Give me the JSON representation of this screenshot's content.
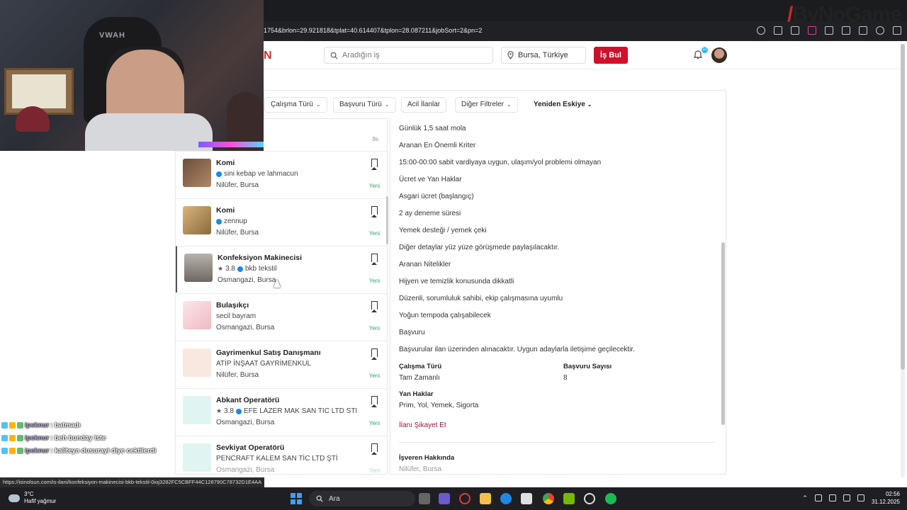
{
  "browser": {
    "url": "1754&brlon=29.921818&tplat=40.614407&tplon=28.087211&jobSort=2&pn=2",
    "status_url": "https://isinolsun.com/is-ilani/konfeksiyon-makinecisi-bkb-tekstil-0ioj3282FC5CBFF44C128790C78732D1E4AA",
    "brand_overlay": "ByNoGame"
  },
  "header": {
    "logo_fragment": "N",
    "search_placeholder": "Aradığın iş",
    "location_value": "Bursa, Türkiye",
    "find_button": "İş Bul",
    "notification_count": "10"
  },
  "filters": {
    "items": [
      "Çalışma Türü",
      "Başvuru Türü",
      "Acil İlanlar",
      "Diğer Filtreler"
    ],
    "sort_label": "Yeniden Eskiye"
  },
  "job_list": {
    "top_time": "9s",
    "new_label": "Yeni",
    "jobs": [
      {
        "title": "Komi",
        "company": "sini kebap ve lahmacun",
        "rating": "",
        "verified": true,
        "location": "Nilüfer, Bursa",
        "thumb_color": "#8a6a52"
      },
      {
        "title": "Komi",
        "company": "zennup",
        "rating": "",
        "verified": true,
        "location": "Nilüfer, Bursa",
        "thumb_color": "#c29a62"
      },
      {
        "title": "Konfeksiyon Makinecisi",
        "company": "bkb tekstil",
        "rating": "3.8",
        "verified": true,
        "location": "Osmangazi, Bursa",
        "thumb_color": "#9b9590"
      },
      {
        "title": "Bulaşıkçı",
        "company": "secil bayram",
        "rating": "",
        "verified": false,
        "location": "Osmangazi, Bursa",
        "thumb_color": "#f2c9cf"
      },
      {
        "title": "Gayrimenkul Satış Danışmanı",
        "company": "ATİP İNŞAAT GAYRİMENKUL",
        "rating": "",
        "verified": false,
        "location": "Nilüfer, Bursa",
        "thumb_color": "#f6e3da"
      },
      {
        "title": "Abkant Operatörü",
        "company": "EFE LAZER MAK SAN TIC LTD STI",
        "rating": "3.8",
        "verified": true,
        "location": "Osmangazi, Bursa",
        "thumb_color": "#d9f2ee"
      },
      {
        "title": "Sevkiyat Operatörü",
        "company": "PENCRAFT KALEM SAN TİC LTD ŞTİ",
        "rating": "",
        "verified": false,
        "location": "Osmangazi, Bursa",
        "thumb_color": "#d9f2ee"
      }
    ]
  },
  "details": {
    "lines": [
      "Günlük 1,5 saat mola",
      "Aranan En Önemli Kriter",
      "15:00-00:00 sabit vardiyaya uygun, ulaşım/yol problemi olmayan",
      "Ücret ve Yan Haklar",
      "Asgari ücret (başlangıç)",
      "2 ay deneme süresi",
      "Yemek desteği / yemek çeki",
      "Diğer detaylar yüz yüze görüşmede paylaşılacaktır.",
      "Aranan Nitelikler",
      "Hijyen ve temizlik konusunda dikkatli",
      "Düzenli, sorumluluk sahibi, ekip çalışmasına uyumlu",
      "Yoğun tempoda çalışabilecek",
      "Başvuru",
      "Başvurular ilan üzerinden alınacaktır. Uygun adaylarla iletişime geçilecektir."
    ],
    "work_type_label": "Çalışma Türü",
    "work_type_value": "Tam Zamanlı",
    "applicants_label": "Başvuru Sayısı",
    "applicants_value": "8",
    "benefits_label": "Yan Haklar",
    "benefits_value": "Prim, Yol, Yemek, Sigorta",
    "report_link": "İlanı Şikayet Et",
    "employer_label": "İşveren Hakkında",
    "employer_location": "Nilüfer, Bursa"
  },
  "chat": [
    {
      "user": "ipeknur",
      "message": ": batmadı"
    },
    {
      "user": "ipeknur",
      "message": ": beh bunday iste"
    },
    {
      "user": "ipeknur",
      "message": ": kaliteyə dusurayi diye cektilerdi"
    }
  ],
  "taskbar": {
    "weather_temp": "3°C",
    "weather_desc": "Hafif yağmur",
    "search_label": "Ara",
    "time": "02:56",
    "date": "31.12.2025"
  }
}
